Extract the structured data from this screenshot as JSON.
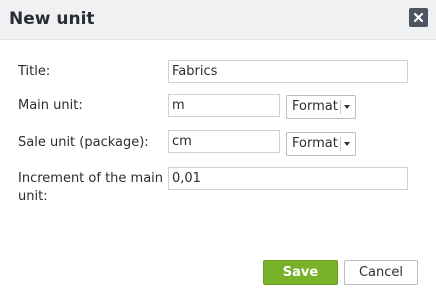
{
  "dialog": {
    "title": "New unit",
    "close_icon": "close-icon"
  },
  "form": {
    "title_label": "Title:",
    "title_value": "Fabrics",
    "main_unit_label": "Main unit:",
    "main_unit_value": "m",
    "main_unit_format_label": "Format",
    "sale_unit_label": "Sale unit (package):",
    "sale_unit_value": "cm",
    "sale_unit_format_label": "Format",
    "increment_label_line1": "Increment of the main",
    "increment_label_line2": "unit:",
    "increment_value": "0,01"
  },
  "actions": {
    "save_label": "Save",
    "cancel_label": "Cancel"
  },
  "colors": {
    "save_bg": "#78b12a",
    "close_bg": "#4c5560",
    "titlebar_bg": "#f0f1f3"
  }
}
